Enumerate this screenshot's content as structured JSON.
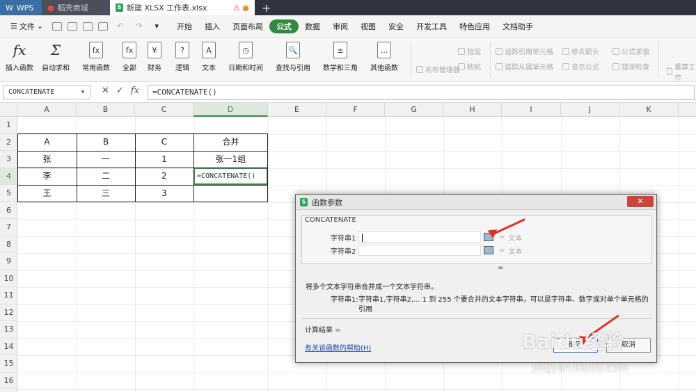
{
  "tabs": {
    "wps": "WPS",
    "store": "稻壳商城",
    "file": "新建 XLSX 工作表.xlsx"
  },
  "menu": {
    "file": "文件",
    "items": [
      "开始",
      "插入",
      "页面布局",
      "公式",
      "数据",
      "审阅",
      "视图",
      "安全",
      "开发工具",
      "特色应用",
      "文档助手"
    ],
    "active": "公式"
  },
  "ribbon": {
    "buttons": [
      "插入函数",
      "自动求和",
      "常用函数",
      "全部",
      "财务",
      "逻辑",
      "文本",
      "日期和时间",
      "查找与引用",
      "数学和三角",
      "其他函数"
    ],
    "icons": [
      "fx",
      "Σ",
      "fx",
      "fx",
      "¥",
      "?",
      "A",
      "◷",
      "🔍",
      "±",
      "…"
    ],
    "small": [
      "名称管理器",
      "指定",
      "粘贴",
      "追踪引用单元格",
      "追踪从属单元格",
      "移去箭头",
      "显示公式",
      "公式求值",
      "错误检查",
      "重算工作"
    ]
  },
  "formula_bar": {
    "name": "CONCATENATE",
    "content": "=CONCATENATE()"
  },
  "columns": [
    "A",
    "B",
    "C",
    "D",
    "E",
    "F",
    "G",
    "H",
    "I",
    "J",
    "K"
  ],
  "rows": [
    "1",
    "2",
    "3",
    "4",
    "5",
    "6",
    "7",
    "8",
    "9",
    "10",
    "11",
    "12",
    "13",
    "14",
    "15",
    "16"
  ],
  "table": {
    "row2": [
      "A",
      "B",
      "C",
      "合并"
    ],
    "row3": [
      "张",
      "一",
      "1",
      "张一1组"
    ],
    "row4": [
      "李",
      "二",
      "2",
      "=CONCATENATE()"
    ],
    "row5": [
      "王",
      "三",
      "3",
      ""
    ]
  },
  "dialog": {
    "title": "函数参数",
    "close": "✕",
    "function": "CONCATENATE",
    "arg1_label": "字符串1",
    "arg1_value": "文本",
    "arg2_label": "字符串2",
    "arg2_value": "文本",
    "eq": "=",
    "result_eq": "=",
    "description": "将多个文本字符串合并成一个文本字符串。",
    "arg_desc_key": "字符串1:",
    "arg_desc": "字符串1,字符串2,... 1 到 255 个要合并的文本字符串，可以是字符串、数字或对单个单元格的引用",
    "calc": "计算结果 =",
    "help": "有关该函数的帮助(H)",
    "ok": "确定",
    "cancel": "取消"
  },
  "watermark": {
    "logo": "Baidu经验",
    "url": "jingyan.baidu.com"
  }
}
